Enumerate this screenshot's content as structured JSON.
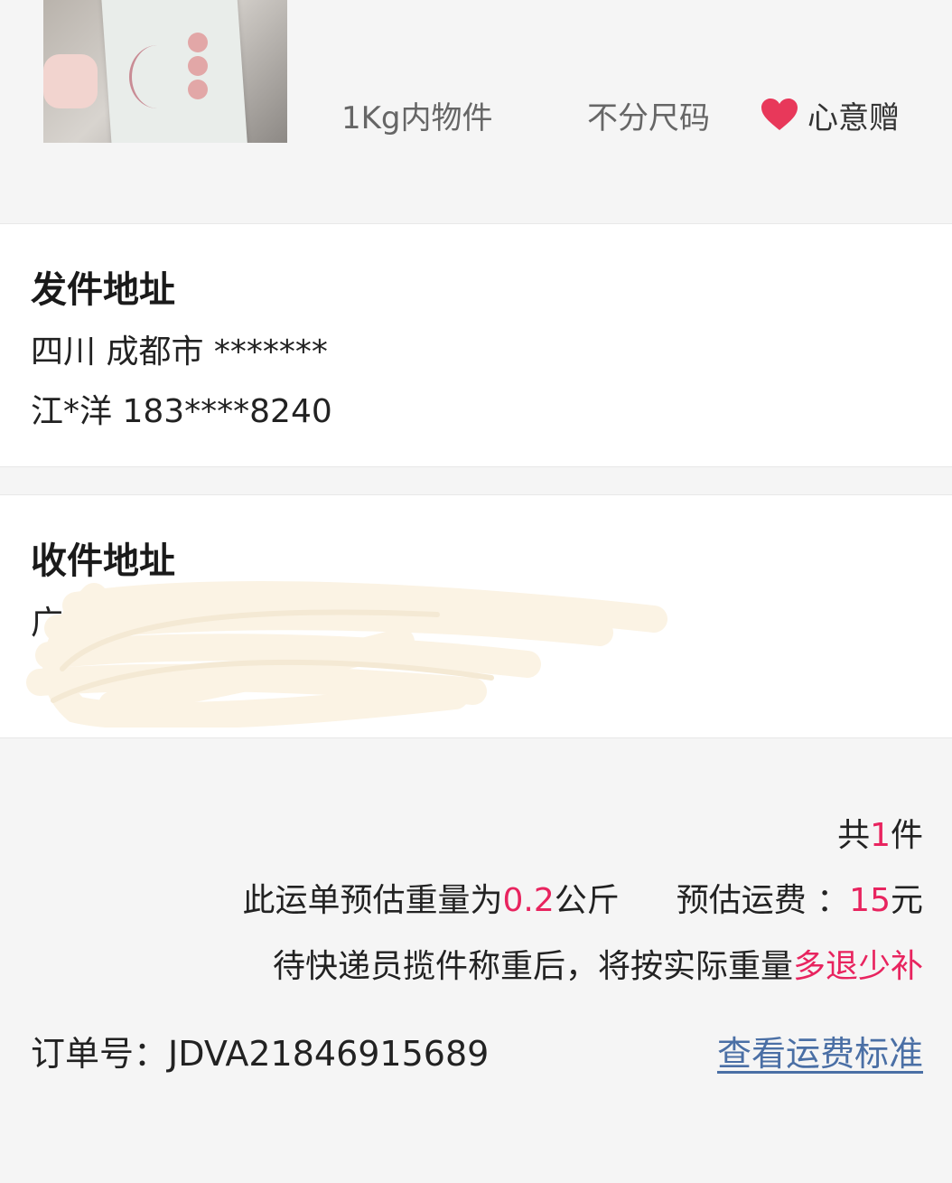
{
  "product": {
    "weight_label": "1Kg内物件",
    "size_label": "不分尺码",
    "gift_label": "心意赠"
  },
  "sender": {
    "title": "发件地址",
    "address": "四川 成都市 *******",
    "contact": "江*洋 183****8240"
  },
  "receiver": {
    "title": "收件地址",
    "address_prefix": "广东",
    "contact_prefix": ""
  },
  "summary": {
    "count_prefix": "共",
    "count": "1",
    "count_suffix": "件",
    "weight_prefix": "此运单预估重量为",
    "weight_value": "0.2",
    "weight_unit": "公斤",
    "fee_prefix": "预估运费 ：",
    "fee_value": "15",
    "fee_unit": "元",
    "note_prefix": "待快递员揽件称重后，将按实际重量",
    "note_highlight": "多退少补"
  },
  "order": {
    "label": "订单号：",
    "number": "JDVA21846915689",
    "fee_standard_link": "查看运费标准"
  },
  "colors": {
    "accent": "#e8245f",
    "link": "#4a6fa5",
    "heart": "#e8385a",
    "background": "#f5f5f5"
  }
}
